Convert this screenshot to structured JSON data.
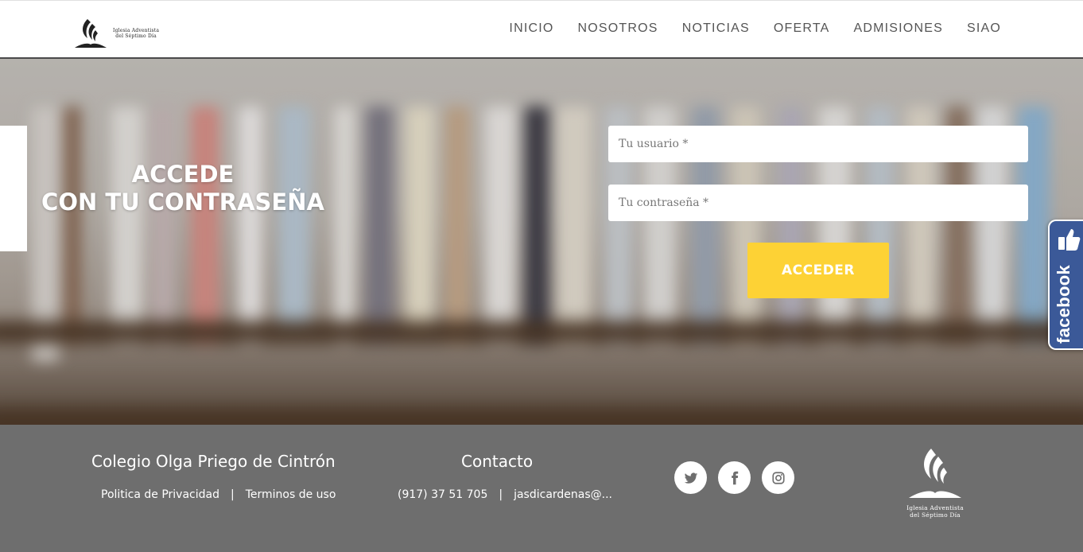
{
  "header": {
    "logo_text_line1": "Iglesia Adventista",
    "logo_text_line2": "del Séptimo Día",
    "nav": [
      {
        "label": "INICIO"
      },
      {
        "label": "NOSOTROS"
      },
      {
        "label": "NOTICIAS"
      },
      {
        "label": "OFERTA"
      },
      {
        "label": "ADMISIONES"
      },
      {
        "label": "SIAO"
      }
    ]
  },
  "hero": {
    "title_line1": "ACCEDE",
    "title_line2": "CON TU CONTRASEÑA",
    "username": {
      "placeholder": "Tu usuario *",
      "value": ""
    },
    "password": {
      "placeholder": "Tu contraseña *",
      "value": ""
    },
    "submit_label": "ACCEDER",
    "facebook_label": "facebook"
  },
  "footer": {
    "school_name": "Colegio Olga Priego de Cintrón",
    "privacy_label": "Politica de Privacidad",
    "separator": "|",
    "terms_label": "Terminos de uso",
    "contact_title": "Contacto",
    "phone": "(917) 37 51 705",
    "email": "jasdicardenas@...",
    "socials": [
      "twitter-icon",
      "facebook-icon",
      "instagram-icon"
    ],
    "logo_text_line1": "Iglesia Adventista",
    "logo_text_line2": "del Séptimo Día"
  },
  "colors": {
    "accent_yellow": "#fdd235",
    "footer_gray": "#6e6e6e",
    "facebook_blue": "#3b5998"
  }
}
